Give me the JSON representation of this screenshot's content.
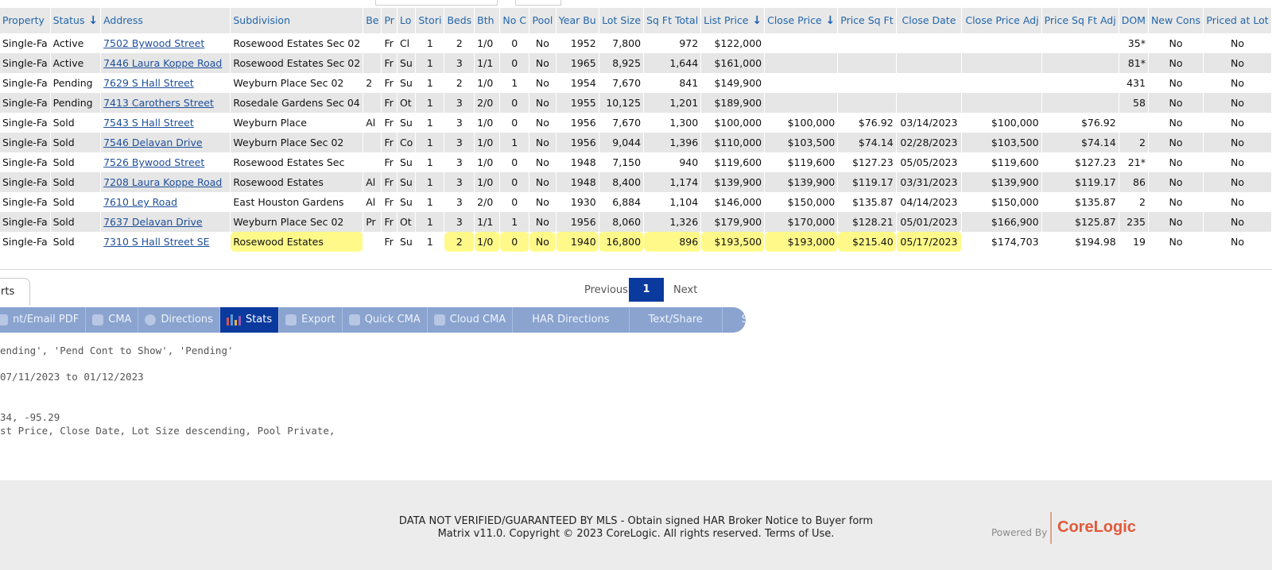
{
  "columns": [
    {
      "label": "Property"
    },
    {
      "label": "Status",
      "sort_icon": "arrow-down-icon"
    },
    {
      "label": "Address"
    },
    {
      "label": "Subdivision"
    },
    {
      "label": "Be"
    },
    {
      "label": "Pr"
    },
    {
      "label": "Lo"
    },
    {
      "label": "Stori"
    },
    {
      "label": "Beds"
    },
    {
      "label": "Bth"
    },
    {
      "label": "No C"
    },
    {
      "label": "Pool"
    },
    {
      "label": "Year Bu"
    },
    {
      "label": "Lot Size"
    },
    {
      "label": "Sq Ft Total"
    },
    {
      "label": "List Price",
      "sort_icon": "arrow-down-icon"
    },
    {
      "label": "Close Price",
      "sort_icon": "arrow-down-icon"
    },
    {
      "label": "Price Sq Ft"
    },
    {
      "label": "Close Date"
    },
    {
      "label": "Close Price Adj"
    },
    {
      "label": "Price Sq Ft Adj"
    },
    {
      "label": "DOM"
    },
    {
      "label": "New Cons"
    },
    {
      "label": "Priced at Lot"
    }
  ],
  "rows": [
    {
      "type": "Single-Fa",
      "status": "Active",
      "address": "7502 Bywood Street",
      "subdivision": "Rosewood Estates Sec 02",
      "be": "",
      "pr": "Fr",
      "lo": "Cl",
      "stories": "1",
      "beds": "2",
      "bth": "1/0",
      "nc": "0",
      "pool": "No",
      "year": "1952",
      "lot": "7,800",
      "sqft": "972",
      "list": "$122,000",
      "close": "",
      "ppsf": "",
      "cdate": "",
      "cadj": "",
      "ppsfadj": "",
      "dom": "35*",
      "newcons": "No",
      "lotprice": "No"
    },
    {
      "type": "Single-Fa",
      "status": "Active",
      "address": "7446 Laura Koppe Road",
      "subdivision": "Rosewood Estates Sec 02",
      "be": "",
      "pr": "Fr",
      "lo": "Su",
      "stories": "1",
      "beds": "3",
      "bth": "1/1",
      "nc": "0",
      "pool": "No",
      "year": "1965",
      "lot": "8,925",
      "sqft": "1,644",
      "list": "$161,000",
      "close": "",
      "ppsf": "",
      "cdate": "",
      "cadj": "",
      "ppsfadj": "",
      "dom": "81*",
      "newcons": "No",
      "lotprice": "No"
    },
    {
      "type": "Single-Fa",
      "status": "Pending",
      "address": "7629 S Hall Street",
      "subdivision": "Weyburn Place Sec 02",
      "be": "2",
      "pr": "Fr",
      "lo": "Su",
      "stories": "1",
      "beds": "2",
      "bth": "1/0",
      "nc": "1",
      "pool": "No",
      "year": "1954",
      "lot": "7,670",
      "sqft": "841",
      "list": "$149,900",
      "close": "",
      "ppsf": "",
      "cdate": "",
      "cadj": "",
      "ppsfadj": "",
      "dom": "431",
      "newcons": "No",
      "lotprice": "No"
    },
    {
      "type": "Single-Fa",
      "status": "Pending",
      "address": "7413 Carothers Street",
      "subdivision": "Rosedale Gardens Sec 04",
      "be": "",
      "pr": "Fr",
      "lo": "Ot",
      "stories": "1",
      "beds": "3",
      "bth": "2/0",
      "nc": "0",
      "pool": "No",
      "year": "1955",
      "lot": "10,125",
      "sqft": "1,201",
      "list": "$189,900",
      "close": "",
      "ppsf": "",
      "cdate": "",
      "cadj": "",
      "ppsfadj": "",
      "dom": "58",
      "newcons": "No",
      "lotprice": "No"
    },
    {
      "type": "Single-Fa",
      "status": "Sold",
      "address": "7543 S Hall Street",
      "subdivision": "Weyburn Place",
      "be": "Al",
      "pr": "Fr",
      "lo": "Su",
      "stories": "1",
      "beds": "3",
      "bth": "1/0",
      "nc": "0",
      "pool": "No",
      "year": "1956",
      "lot": "7,670",
      "sqft": "1,300",
      "list": "$100,000",
      "close": "$100,000",
      "ppsf": "$76.92",
      "cdate": "03/14/2023",
      "cadj": "$100,000",
      "ppsfadj": "$76.92",
      "dom": "",
      "newcons": "No",
      "lotprice": "No"
    },
    {
      "type": "Single-Fa",
      "status": "Sold",
      "address": "7546 Delavan Drive",
      "subdivision": "Weyburn Place Sec 02",
      "be": "",
      "pr": "Fr",
      "lo": "Co",
      "stories": "1",
      "beds": "3",
      "bth": "1/0",
      "nc": "1",
      "pool": "No",
      "year": "1956",
      "lot": "9,044",
      "sqft": "1,396",
      "list": "$110,000",
      "close": "$103,500",
      "ppsf": "$74.14",
      "cdate": "02/28/2023",
      "cadj": "$103,500",
      "ppsfadj": "$74.14",
      "dom": "2",
      "newcons": "No",
      "lotprice": "No"
    },
    {
      "type": "Single-Fa",
      "status": "Sold",
      "address": "7526 Bywood Street",
      "subdivision": "Rosewood Estates Sec",
      "be": "",
      "pr": "Fr",
      "lo": "Su",
      "stories": "1",
      "beds": "3",
      "bth": "1/0",
      "nc": "0",
      "pool": "No",
      "year": "1948",
      "lot": "7,150",
      "sqft": "940",
      "list": "$119,600",
      "close": "$119,600",
      "ppsf": "$127.23",
      "cdate": "05/05/2023",
      "cadj": "$119,600",
      "ppsfadj": "$127.23",
      "dom": "21*",
      "newcons": "No",
      "lotprice": "No"
    },
    {
      "type": "Single-Fa",
      "status": "Sold",
      "address": "7208 Laura Koppe Road",
      "subdivision": "Rosewood Estates",
      "be": "Al",
      "pr": "Fr",
      "lo": "Su",
      "stories": "1",
      "beds": "3",
      "bth": "1/0",
      "nc": "0",
      "pool": "No",
      "year": "1948",
      "lot": "8,400",
      "sqft": "1,174",
      "list": "$139,900",
      "close": "$139,900",
      "ppsf": "$119.17",
      "cdate": "03/31/2023",
      "cadj": "$139,900",
      "ppsfadj": "$119.17",
      "dom": "86",
      "newcons": "No",
      "lotprice": "No"
    },
    {
      "type": "Single-Fa",
      "status": "Sold",
      "address": "7610 Ley Road",
      "subdivision": "East Houston Gardens",
      "be": "Al",
      "pr": "Fr",
      "lo": "Su",
      "stories": "1",
      "beds": "3",
      "bth": "2/0",
      "nc": "0",
      "pool": "No",
      "year": "1930",
      "lot": "6,884",
      "sqft": "1,104",
      "list": "$146,000",
      "close": "$150,000",
      "ppsf": "$135.87",
      "cdate": "04/14/2023",
      "cadj": "$150,000",
      "ppsfadj": "$135.87",
      "dom": "2",
      "newcons": "No",
      "lotprice": "No"
    },
    {
      "type": "Single-Fa",
      "status": "Sold",
      "address": "7637 Delavan Drive",
      "subdivision": "Weyburn Place Sec 02",
      "be": "Pr",
      "pr": "Fr",
      "lo": "Ot",
      "stories": "1",
      "beds": "3",
      "bth": "1/1",
      "nc": "1",
      "pool": "No",
      "year": "1956",
      "lot": "8,060",
      "sqft": "1,326",
      "list": "$179,900",
      "close": "$170,000",
      "ppsf": "$128.21",
      "cdate": "05/01/2023",
      "cadj": "$166,900",
      "ppsfadj": "$125.87",
      "dom": "235",
      "newcons": "No",
      "lotprice": "No"
    },
    {
      "type": "Single-Fa",
      "status": "Sold",
      "address": "7310 S Hall Street SE",
      "subdivision": "Rosewood Estates",
      "be": "",
      "pr": "Fr",
      "lo": "Su",
      "stories": "1",
      "beds": "2",
      "bth": "1/0",
      "nc": "0",
      "pool": "No",
      "year": "1940",
      "lot": "16,800",
      "sqft": "896",
      "list": "$193,500",
      "close": "$193,000",
      "ppsf": "$215.40",
      "cdate": "05/17/2023",
      "cadj": "$174,703",
      "ppsfadj": "$194.98",
      "dom": "19",
      "newcons": "No",
      "lotprice": "No"
    }
  ],
  "left_tab": {
    "label": "rts"
  },
  "pager": {
    "previous": "Previous",
    "current": "1",
    "next": "Next"
  },
  "actions": [
    {
      "label": "nt/Email PDF",
      "icon": "pdf-icon"
    },
    {
      "label": "CMA",
      "icon": "cma-icon"
    },
    {
      "label": "Directions",
      "icon": "compass-icon"
    },
    {
      "label": "Stats",
      "icon": "bar-chart-icon",
      "active": true
    },
    {
      "label": "Export",
      "icon": "export-icon"
    },
    {
      "label": "Quick CMA",
      "icon": "quick-cma-icon"
    },
    {
      "label": "Cloud CMA",
      "icon": "cloud-cma-icon"
    },
    {
      "label": "HAR Directions",
      "icon": ""
    },
    {
      "label": "Text/Share",
      "icon": ""
    },
    {
      "label": "ShowingSmart",
      "icon": ""
    }
  ],
  "criteria": {
    "status": "ending', 'Pend Cont to Show', 'Pending'",
    "dates": " 07/11/2023 to 01/12/2023",
    "coords": "34, -95.29",
    "sort": "st Price, Close Date, Lot Size descending, Pool Private,"
  },
  "footer": {
    "line1": "DATA NOT VERIFIED/GUARANTEED BY MLS - Obtain signed HAR Broker Notice to Buyer form",
    "line2": "Matrix v11.0. Copyright © 2023 CoreLogic. All rights reserved. Terms of Use.",
    "powered_by": "Powered By",
    "brand": "CoreLogic",
    "brand_color": "#e05a3a"
  },
  "colors": {
    "accent": "#0b3a9e",
    "header_text": "#2266aa",
    "link": "#1f4f9a",
    "action_bar": "#8aa3cf",
    "highlight": "#fff53c"
  }
}
